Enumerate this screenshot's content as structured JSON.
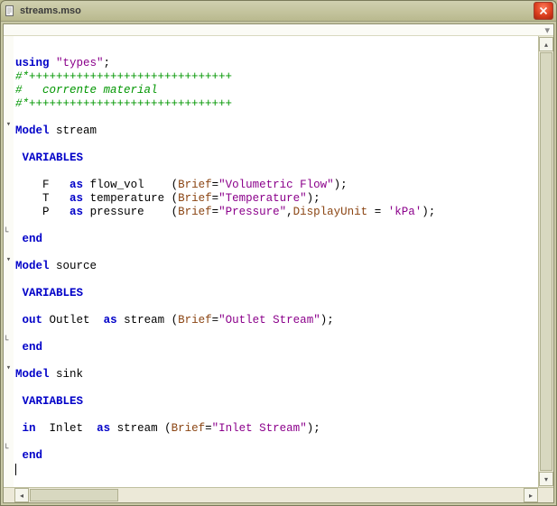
{
  "window": {
    "title": "streams.mso"
  },
  "code": {
    "using_kw": "using",
    "using_arg": "\"types\"",
    "hr1": "#*++++++++++++++++++++++++++++++",
    "cmt": "#   corrente material",
    "hr2": "#*++++++++++++++++++++++++++++++",
    "model_kw": "Model",
    "variables_kw": "VARIABLES",
    "end_kw": "end",
    "as_kw": "as",
    "out_kw": "out",
    "in_kw": "in",
    "brief_attr": "Brief",
    "dispunit_attr": "DisplayUnit",
    "m1_name": "stream",
    "m1_v1_name": "F",
    "m1_v1_type": "flow_vol",
    "m1_v1_brief": "\"Volumetric Flow\"",
    "m1_v2_name": "T",
    "m1_v2_type": "temperature",
    "m1_v2_brief": "\"Temperature\"",
    "m1_v3_name": "P",
    "m1_v3_type": "pressure",
    "m1_v3_brief": "\"Pressure\"",
    "m1_v3_du": "'kPa'",
    "m2_name": "source",
    "m2_port": "Outlet",
    "m2_ptype": "stream",
    "m2_brief": "\"Outlet Stream\"",
    "m3_name": "sink",
    "m3_port": "Inlet",
    "m3_ptype": "stream",
    "m3_brief": "\"Inlet Stream\""
  }
}
